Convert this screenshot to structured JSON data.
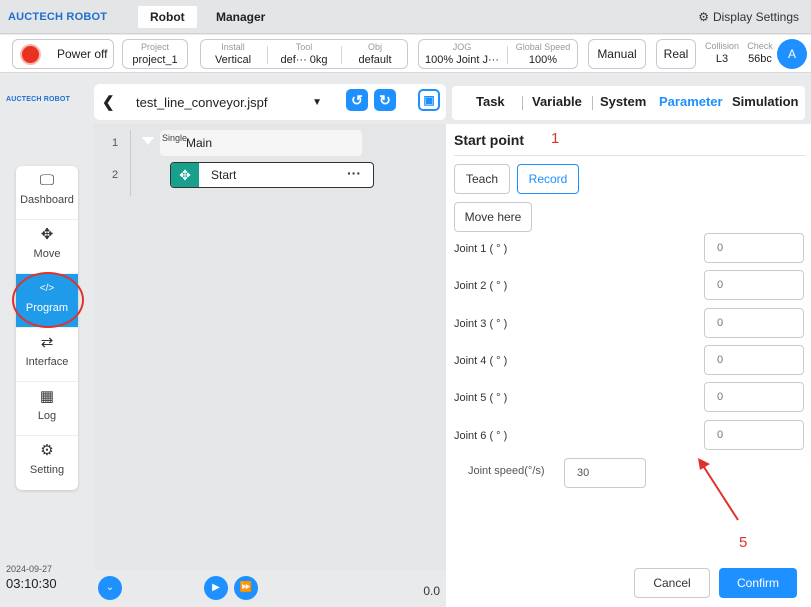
{
  "topnav": {
    "brand": "AUCTECH ROBOT",
    "tabs": [
      {
        "label": "Robot"
      },
      {
        "label": "Manager"
      }
    ],
    "display_settings": "Display Settings"
  },
  "statusbar": {
    "power": "Power off",
    "project": {
      "caption": "Project",
      "value": "project_1"
    },
    "install": {
      "caption": "Install",
      "value": "Vertical"
    },
    "tool": {
      "caption": "Tool",
      "value": "def··· 0kg"
    },
    "obj": {
      "caption": "Obj",
      "value": "default"
    },
    "jog": {
      "caption": "JOG",
      "value": "100% Joint J···"
    },
    "global_speed": {
      "caption": "Global Speed",
      "value": "100%"
    },
    "mode_manual": "Manual",
    "mode_real": "Real",
    "collision": {
      "caption": "Collision",
      "value": "L3"
    },
    "check": {
      "caption": "Check",
      "value": "56bc"
    },
    "avatar": "A"
  },
  "sidebar": {
    "logo": "AUCTECH ROBOT",
    "items": [
      {
        "label": "Dashboard",
        "icon": "monitor-icon",
        "glyph": "🖵"
      },
      {
        "label": "Move",
        "icon": "move-icon",
        "glyph": "✥"
      },
      {
        "label": "Program",
        "icon": "code-icon",
        "glyph": "</>"
      },
      {
        "label": "Interface",
        "icon": "swap-icon",
        "glyph": "⇄"
      },
      {
        "label": "Log",
        "icon": "calendar-icon",
        "glyph": "▦"
      },
      {
        "label": "Setting",
        "icon": "gear-icon",
        "glyph": "⚙"
      }
    ],
    "active": "Program",
    "date": "2024-09-27",
    "time": "03:10:30"
  },
  "program": {
    "file": "test_line_conveyor.jspf",
    "lines": [
      {
        "num": "1",
        "label": "Main",
        "sub": "Single"
      },
      {
        "num": "2",
        "label": "Start"
      }
    ],
    "more": "···",
    "speed_value": "0.0"
  },
  "right": {
    "tabs": [
      "Task",
      "Variable",
      "System",
      "Parameter",
      "Simulation"
    ],
    "active_tab": "Parameter",
    "title": "Start point",
    "annotation_1": "1",
    "teach": "Teach",
    "record": "Record",
    "move_here": "Move here",
    "joints": [
      {
        "label": "Joint 1 ( ° )",
        "value": "0"
      },
      {
        "label": "Joint 2 ( ° )",
        "value": "0"
      },
      {
        "label": "Joint 3 ( ° )",
        "value": "0"
      },
      {
        "label": "Joint 4 ( ° )",
        "value": "0"
      },
      {
        "label": "Joint 5 ( ° )",
        "value": "0"
      },
      {
        "label": "Joint 6 ( ° )",
        "value": "0"
      }
    ],
    "joint_speed_label": "Joint speed(°/s)",
    "joint_speed_value": "30",
    "annotation_5": "5",
    "cancel": "Cancel",
    "confirm": "Confirm"
  },
  "colors": {
    "accent": "#1e90ff",
    "power_red": "#e8311f",
    "move_teal": "#19a08d",
    "annotation_red": "#e0322c"
  }
}
